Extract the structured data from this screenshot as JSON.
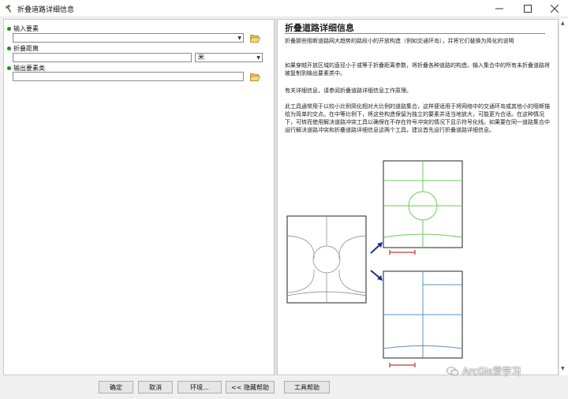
{
  "window": {
    "title": "折叠道路详细信息",
    "controls": [
      "minimize",
      "maximize",
      "close"
    ]
  },
  "params": {
    "input_features": {
      "label": "输入要素",
      "value": ""
    },
    "collapse_distance": {
      "label": "折叠距离",
      "value": "",
      "unit": "米"
    },
    "output_feature_class": {
      "label": "输出要素类",
      "value": ""
    }
  },
  "help": {
    "title": "折叠道路详细信息",
    "para1": "折叠那些阻断道路网大趋势的路段小的开放构造（例如交通环岛），并将它们替换为简化的说明",
    "para2": "如果穿越开放区域的直径小于或等于折叠距离参数，将折叠各种道路的构造。输入集合中的所有未折叠道路将被复制到输出要素类中。",
    "para3": "有关详细信息，请参阅折叠道路详细信息工作原理。",
    "para4": "此工具通常用于以较小比例简化相对大比例的道路集合，这样便适用于将网络中的交通环岛或其他小的阻断描绘为简单的交点。在中等比例下，将这些构造保留为独立的要素并适当地放大，可能更为合适。在这种情况下，可转而使用解决道路冲突工具以确保在不存在符号冲突的情况下显示符号化线。如果要在同一道路集合中运行解决道路冲突和折叠道路详细信息这两个工具，建议首先运行折叠道路详细信息。"
  },
  "buttons": {
    "ok": "确定",
    "cancel": "取消",
    "environments": "环境...",
    "hide_help": "<< 隐藏帮助",
    "tool_help": "工具帮助"
  },
  "watermark": "ArcGis爱学习",
  "colors": {
    "road_gray": "#9a9a9a",
    "road_green": "#6ecb5c",
    "road_blue": "#5b8fc7",
    "arrow_blue": "#1f2f8f",
    "scale_red": "#c0392b",
    "required_bullet": "#1c8f1c"
  },
  "icons": [
    "hammer-icon",
    "folder-open-icon",
    "chevron-down-icon",
    "wechat-icon"
  ]
}
